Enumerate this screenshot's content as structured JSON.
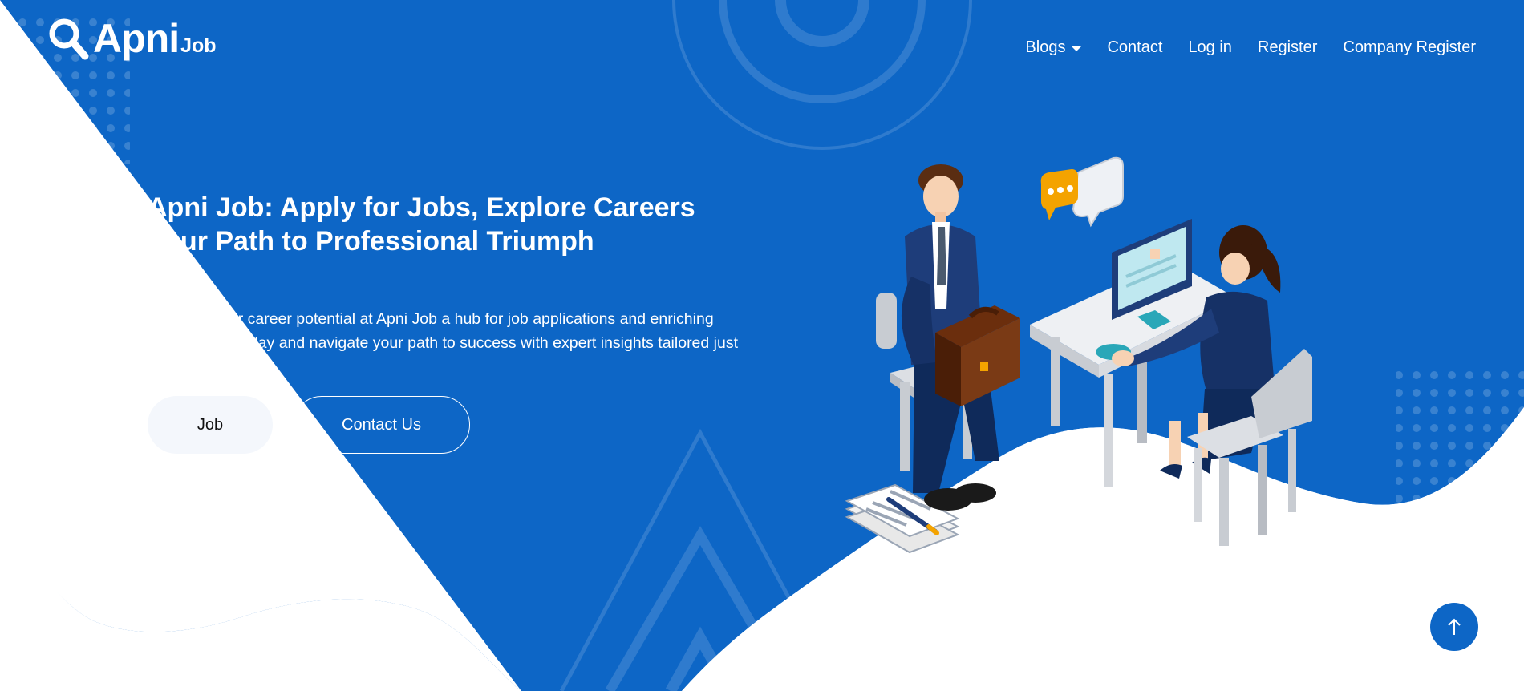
{
  "brand": {
    "name": "Apni",
    "suffix": "Job"
  },
  "nav": {
    "items": [
      {
        "label": "Blogs",
        "has_dropdown": true
      },
      {
        "label": "Contact"
      },
      {
        "label": "Log in"
      },
      {
        "label": "Register"
      },
      {
        "label": "Company Register"
      }
    ]
  },
  "hero": {
    "title": "Apni Job: Apply for Jobs, Explore Careers Your Path to Professional Triumph",
    "description": "Discover your career potential at Apni Job a hub for job applications and enriching blogs. Apply today and navigate your path to success with expert insights tailored just for you.",
    "primary_button": "Job",
    "secondary_button": "Contact Us"
  },
  "icons": {
    "logo": "search-icon",
    "dropdown": "chevron-down-icon",
    "back_to_top": "arrow-up-icon"
  },
  "colors": {
    "primary_blue": "#0d66c6",
    "text_light": "#ffffff",
    "button_light": "#f4f7fc"
  }
}
